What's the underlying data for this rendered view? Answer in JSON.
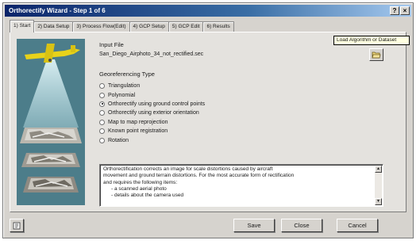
{
  "window": {
    "title": "Orthorectify Wizard - Step 1 of 6",
    "title_buttons": [
      "?",
      "×"
    ]
  },
  "tabs": [
    {
      "label": "1) Start"
    },
    {
      "label": "2) Data Setup"
    },
    {
      "label": "3) Process Flow(Edit)"
    },
    {
      "label": "4) GCP Setup"
    },
    {
      "label": "5) GCP Edit"
    },
    {
      "label": "6) Results"
    }
  ],
  "input_file": {
    "label": "Input File",
    "value": "San_Diego_Airphoto_34_not_rectified.sec",
    "load_button_icon": "folder-open-icon",
    "tooltip": "Load Algorithm or Dataset"
  },
  "georef": {
    "label": "Georeferencing Type",
    "options": [
      {
        "label": "Triangulation",
        "checked": false
      },
      {
        "label": "Polynomial",
        "checked": false
      },
      {
        "label": "Orthorectify using ground control points",
        "checked": true
      },
      {
        "label": "Orthorectify using exterior orientation",
        "checked": false
      },
      {
        "label": "Map to map reprojection",
        "checked": false
      },
      {
        "label": "Known point registration",
        "checked": false
      },
      {
        "label": "Rotation",
        "checked": false
      }
    ]
  },
  "description": {
    "lines": [
      "Orthorectification corrects an image for scale distortions caused by aircraft",
      "movement and ground terrain distortions. For the most accurate form of rectification",
      "and requires the following items:",
      "- a scanned aerial photo",
      "- details about the camera used"
    ]
  },
  "footer": {
    "help_icon": "help-icon",
    "save_label": "Save",
    "close_label": "Close",
    "cancel_label": "Cancel"
  },
  "colors": {
    "title_bar": "#0a246a",
    "panel": "#e4e2de",
    "illustration_bg": "#4c7d8a",
    "plane": "#e8d21a"
  }
}
